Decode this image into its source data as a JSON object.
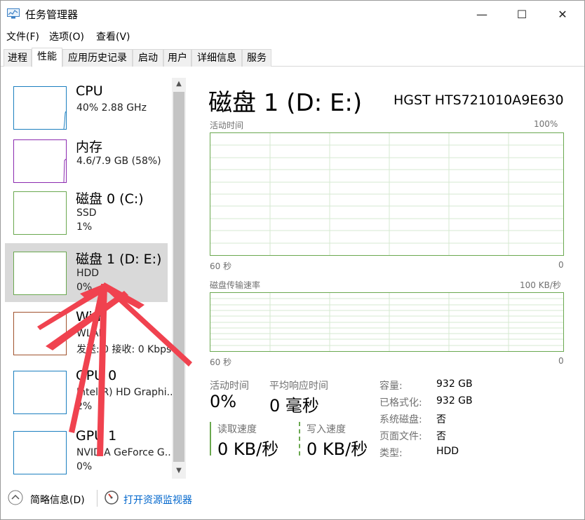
{
  "window": {
    "title": "任务管理器",
    "minimize": "—",
    "maximize": "☐",
    "close": "✕"
  },
  "menu": [
    "文件(F)",
    "选项(O)",
    "查看(V)"
  ],
  "tabs": [
    "进程",
    "性能",
    "应用历史记录",
    "启动",
    "用户",
    "详细信息",
    "服务"
  ],
  "active_tab": 1,
  "sidebar": {
    "items": [
      {
        "title": "CPU",
        "line1": "40%  2.88 GHz",
        "line2": "",
        "color": "#1c7fbf"
      },
      {
        "title": "内存",
        "line1": "4.6/7.9 GB (58%)",
        "line2": "",
        "color": "#8b2ab0"
      },
      {
        "title": "磁盘 0 (C:)",
        "line1": "SSD",
        "line2": "1%",
        "color": "#6aa84f"
      },
      {
        "title": "磁盘 1 (D: E:)",
        "line1": "HDD",
        "line2": "0%",
        "color": "#6aa84f"
      },
      {
        "title": "Wi-Fi",
        "line1": "WLAN",
        "line2": "发送: 0 接收: 0 Kbps",
        "color": "#a0522d"
      },
      {
        "title": "GPU 0",
        "line1": "Intel(R) HD Graphi...",
        "line2": "2%",
        "color": "#1c7fbf"
      },
      {
        "title": "GPU 1",
        "line1": "NVIDIA GeForce G...",
        "line2": "0%",
        "color": "#1c7fbf"
      }
    ],
    "selected": 3
  },
  "detail": {
    "title": "磁盘 1 (D: E:)",
    "model": "HGST HTS721010A9E630",
    "graph1": {
      "label": "活动时间",
      "max": "100%",
      "time": "60 秒",
      "min": "0"
    },
    "graph2": {
      "label": "磁盘传输速率",
      "max": "100 KB/秒",
      "time": "60 秒",
      "min": "0"
    },
    "stats": {
      "active_time_label": "活动时间",
      "active_time": "0%",
      "avg_response_label": "平均响应时间",
      "avg_response": "0 毫秒",
      "read_label": "读取速度",
      "read": "0 KB/秒",
      "write_label": "写入速度",
      "write": "0 KB/秒"
    },
    "props": [
      {
        "key": "容量:",
        "value": "932 GB"
      },
      {
        "key": "已格式化:",
        "value": "932 GB"
      },
      {
        "key": "系统磁盘:",
        "value": "否"
      },
      {
        "key": "页面文件:",
        "value": "否"
      },
      {
        "key": "类型:",
        "value": "HDD"
      }
    ]
  },
  "footer": {
    "brief": "简略信息(D)",
    "monitor": "打开资源监视器"
  },
  "colors": {
    "disk": "#6aa84f",
    "link": "#0066cc",
    "arrow": "#f0424f"
  }
}
